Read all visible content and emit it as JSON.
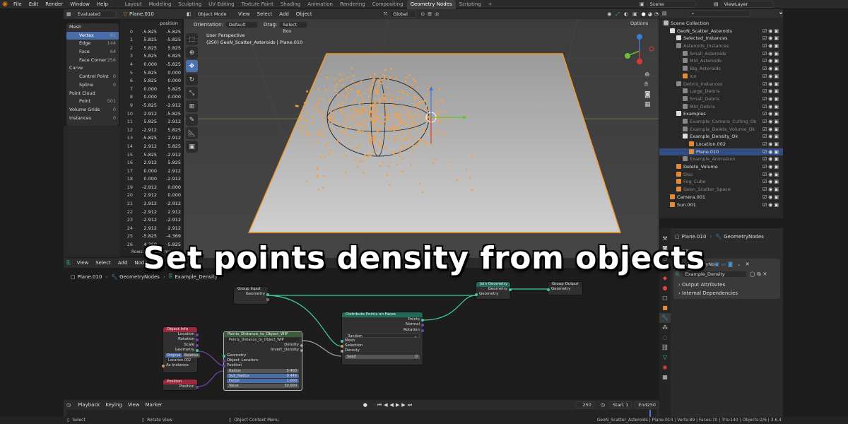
{
  "topbar": {
    "menus": [
      "File",
      "Edit",
      "Render",
      "Window",
      "Help"
    ],
    "workspaces": [
      "Layout",
      "Modeling",
      "Sculpting",
      "UV Editing",
      "Texture Paint",
      "Shading",
      "Animation",
      "Rendering",
      "Compositing",
      "Geometry Nodes",
      "Scripting"
    ],
    "active_workspace": "Geometry Nodes",
    "scene": "Scene",
    "view_layer": "ViewLayer"
  },
  "spreadsheet": {
    "mode": "Evaluated",
    "object": "Plane.010",
    "column_header": "position",
    "tree": [
      {
        "label": "Mesh",
        "count": "",
        "level": 0,
        "selected": false
      },
      {
        "label": "Vertex",
        "count": "81",
        "level": 1,
        "selected": true
      },
      {
        "label": "Edge",
        "count": "144",
        "level": 1,
        "selected": false
      },
      {
        "label": "Face",
        "count": "64",
        "level": 1,
        "selected": false
      },
      {
        "label": "Face Corner",
        "count": "256",
        "level": 1,
        "selected": false
      },
      {
        "label": "Curve",
        "count": "",
        "level": 0,
        "selected": false
      },
      {
        "label": "Control Point",
        "count": "0",
        "level": 1,
        "selected": false
      },
      {
        "label": "Spline",
        "count": "0",
        "level": 1,
        "selected": false
      },
      {
        "label": "Point Cloud",
        "count": "",
        "level": 0,
        "selected": false
      },
      {
        "label": "Point",
        "count": "501",
        "level": 1,
        "selected": false
      },
      {
        "label": "Volume Grids",
        "count": "0",
        "level": 0,
        "selected": false
      },
      {
        "label": "Instances",
        "count": "0",
        "level": 0,
        "selected": false
      }
    ],
    "rows": [
      [
        "0",
        "-5.825",
        "-5.825"
      ],
      [
        "1",
        "5.825",
        "-5.825"
      ],
      [
        "2",
        "5.825",
        "5.825"
      ],
      [
        "3",
        "5.825",
        "5.825"
      ],
      [
        "4",
        "0.000",
        "-5.825"
      ],
      [
        "5",
        "5.825",
        "0.000"
      ],
      [
        "6",
        "5.825",
        "0.000"
      ],
      [
        "7",
        "0.000",
        "5.825"
      ],
      [
        "8",
        "0.000",
        "0.000"
      ],
      [
        "9",
        "-5.825",
        "-2.912"
      ],
      [
        "10",
        "2.912",
        "-5.825"
      ],
      [
        "11",
        "5.825",
        "2.912"
      ],
      [
        "12",
        "-2.912",
        "5.825"
      ],
      [
        "13",
        "-5.825",
        "2.912"
      ],
      [
        "14",
        "2.912",
        "5.825"
      ],
      [
        "15",
        "5.825",
        "-2.912"
      ],
      [
        "16",
        "2.912",
        "5.825"
      ],
      [
        "17",
        "0.000",
        "2.912"
      ],
      [
        "18",
        "0.000",
        "-2.912"
      ],
      [
        "19",
        "-2.912",
        "0.000"
      ],
      [
        "20",
        "2.912",
        "0.000"
      ],
      [
        "21",
        "2.912",
        "-2.912"
      ],
      [
        "22",
        "-2.912",
        "2.912"
      ],
      [
        "23",
        "-2.912",
        "-2.912"
      ],
      [
        "24",
        "2.912",
        "2.912"
      ],
      [
        "25",
        "-5.825",
        "-4.369"
      ],
      [
        "26",
        "4.369",
        "-5.825"
      ],
      [
        "27",
        "5.825",
        "4.369"
      ],
      [
        "28",
        "-4.369",
        "5.825"
      ]
    ],
    "status": "Rows: 81 | Columns: 1"
  },
  "viewport": {
    "mode": "Object Mode",
    "menus": [
      "View",
      "Select",
      "Add",
      "Object"
    ],
    "orientation_label": "Orientation:",
    "orientation": "Default",
    "drag_label": "Drag:",
    "drag": "Select Box",
    "transform": "Global",
    "options": "Options",
    "info_line1": "User Perspective",
    "info_line2": "(250) GeoN_Scatter_Asteroids | Plane.010"
  },
  "outliner": {
    "search_placeholder": "",
    "items": [
      {
        "label": "Scene Collection",
        "level": 0,
        "dim": false,
        "sel": false,
        "color": "#bbbbbb"
      },
      {
        "label": "GeoN_Scatter_Asteroids",
        "level": 1,
        "dim": false,
        "sel": false,
        "color": "#dddddd"
      },
      {
        "label": "Selected_Instances",
        "level": 2,
        "dim": false,
        "sel": false,
        "color": "#dddddd"
      },
      {
        "label": "Asteroids_Instances",
        "level": 2,
        "dim": true,
        "sel": false,
        "color": "#888888"
      },
      {
        "label": "Small_Asteroids",
        "level": 3,
        "dim": true,
        "sel": false,
        "color": "#888888"
      },
      {
        "label": "Mid_Asteroids",
        "level": 3,
        "dim": true,
        "sel": false,
        "color": "#888888"
      },
      {
        "label": "Big_Asteroids",
        "level": 3,
        "dim": true,
        "sel": false,
        "color": "#888888"
      },
      {
        "label": "Ico",
        "level": 3,
        "dim": true,
        "sel": false,
        "color": "#e08a3a"
      },
      {
        "label": "Debris_Instances",
        "level": 2,
        "dim": true,
        "sel": false,
        "color": "#888888"
      },
      {
        "label": "Large_Debris",
        "level": 3,
        "dim": true,
        "sel": false,
        "color": "#888888"
      },
      {
        "label": "Small_Debris",
        "level": 3,
        "dim": true,
        "sel": false,
        "color": "#888888"
      },
      {
        "label": "Mid_Debris",
        "level": 3,
        "dim": true,
        "sel": false,
        "color": "#888888"
      },
      {
        "label": "Examples",
        "level": 2,
        "dim": false,
        "sel": false,
        "color": "#dddddd"
      },
      {
        "label": "Example_Camera_Culling_Ok",
        "level": 3,
        "dim": true,
        "sel": false,
        "color": "#888888"
      },
      {
        "label": "Example_Delete_Volume_Ok",
        "level": 3,
        "dim": true,
        "sel": false,
        "color": "#888888"
      },
      {
        "label": "Example_Density_Ok",
        "level": 3,
        "dim": false,
        "sel": false,
        "color": "#dddddd"
      },
      {
        "label": "Location.002",
        "level": 4,
        "dim": false,
        "sel": false,
        "color": "#e08a3a"
      },
      {
        "label": "Plane.010",
        "level": 4,
        "dim": false,
        "sel": true,
        "color": "#e08a3a"
      },
      {
        "label": "Example_Animation",
        "level": 3,
        "dim": true,
        "sel": false,
        "color": "#888888"
      },
      {
        "label": "Delete_Volume",
        "level": 2,
        "dim": false,
        "sel": false,
        "color": "#e08a3a"
      },
      {
        "label": "Disc",
        "level": 2,
        "dim": true,
        "sel": false,
        "color": "#e08a3a"
      },
      {
        "label": "Fog_Cube",
        "level": 2,
        "dim": true,
        "sel": false,
        "color": "#e08a3a"
      },
      {
        "label": "Geon_Scatter_Space",
        "level": 2,
        "dim": true,
        "sel": false,
        "color": "#e08a3a"
      },
      {
        "label": "Camera.001",
        "level": 1,
        "dim": false,
        "sel": false,
        "color": "#e08a3a"
      },
      {
        "label": "Sun.001",
        "level": 1,
        "dim": false,
        "sel": false,
        "color": "#e08a3a"
      }
    ]
  },
  "properties": {
    "object": "Plane.010",
    "modifier_tab": "GeometryNodes",
    "section": "Modifier",
    "modifier_name": "GeometryNo",
    "node_group": "Example_Density",
    "sub1": "Output Attributes",
    "sub2": "Internal Dependencies"
  },
  "node_editor": {
    "menus": [
      "View",
      "Select",
      "Add",
      "Node"
    ],
    "breadcrumb": [
      "Plane.010",
      "GeometryNodes",
      "Example_Density"
    ],
    "nodes": {
      "group_input": {
        "title": "Group Input",
        "geometry": "Geometry"
      },
      "group_output": {
        "title": "Group Output",
        "geometry": "Geometry"
      },
      "join": {
        "title": "Join Geometry",
        "out": "Geometry",
        "in": "Geometry"
      },
      "distribute": {
        "title": "Distribute Points on Faces",
        "points": "Points",
        "normal": "Normal",
        "rotation": "Rotation",
        "mode": "Random",
        "mesh": "Mesh",
        "selection": "Selection",
        "density": "Density",
        "seed_label": "Seed",
        "seed": "0"
      },
      "object_info": {
        "title": "Object Info",
        "location": "Location",
        "rotation": "Rotation",
        "scale": "Scale",
        "geometry": "Geometry",
        "original": "Original",
        "relative": "Relative",
        "object": "Location.002",
        "as_instance": "As Instance"
      },
      "position": {
        "title": "Position",
        "out": "Position"
      },
      "points_distance": {
        "title": "Points_Distance_to_Object_WIP",
        "group": "Points_Distance_to_Object_WIP",
        "density": "Density",
        "invert": "Invert_Density",
        "geometry": "Geometry",
        "obj_loc": "Object_Location",
        "position": "Position",
        "radius_l": "Radius",
        "radius": "5.400",
        "sub_radius_l": "Sub_Radius",
        "sub_radius": "0.449",
        "factor_l": "Factor",
        "factor": "1.000",
        "value_l": "Value",
        "value": "50.000"
      }
    }
  },
  "overlay_text": "Set points density from objects",
  "timeline": {
    "menus": [
      "Playback",
      "Keying",
      "View",
      "Marker"
    ],
    "current": "250",
    "start_label": "Start",
    "start": "1",
    "end_label": "End",
    "end": "250"
  },
  "statusbar": {
    "select": "Select",
    "rotate": "Rotate View",
    "context": "Object Context Menu",
    "stats": "GeoN_Scatter_Asteroids | Plane.010 | Verts:89 | Faces:70 | Tris:140 | Objects:2/6 | 3.6.4"
  },
  "colors": {
    "accent": "#4a6da8",
    "plane": "#c8c8c8",
    "points": "#f2a04a",
    "selection": "#f29c2b",
    "link": "#3fc8a0"
  }
}
